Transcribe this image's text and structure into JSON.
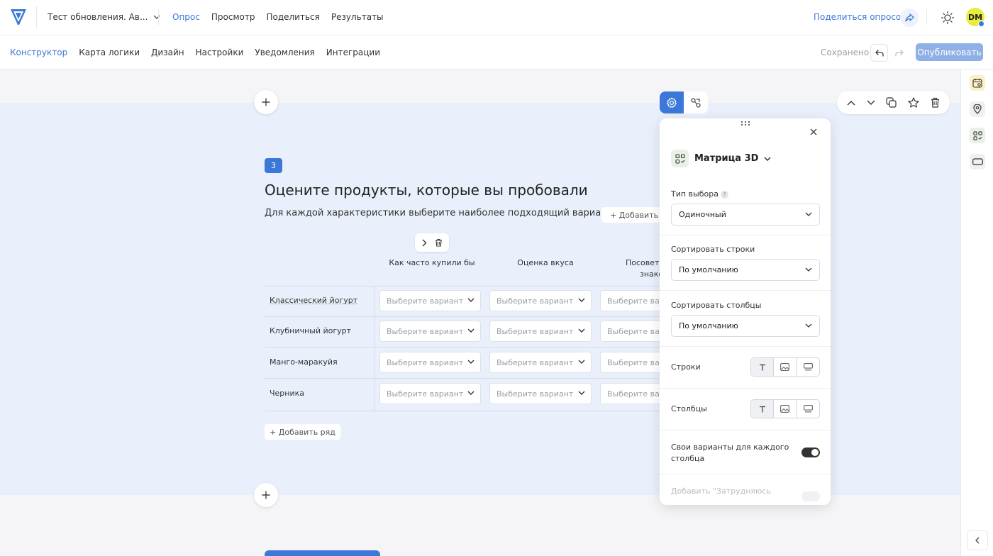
{
  "header": {
    "survey_title": "Тест обновления. Ав...",
    "nav": [
      "Опрос",
      "Просмотр",
      "Поделиться",
      "Результаты"
    ],
    "share_survey": "Поделиться опросом",
    "avatar": "DM"
  },
  "subheader": {
    "tabs": [
      "Конструктор",
      "Карта логики",
      "Дизайн",
      "Настройки",
      "Уведомления",
      "Интеграции"
    ],
    "saved": "Сохранено",
    "publish": "Опубликовать"
  },
  "question": {
    "number": "3",
    "title": "Оцените продукты, которые вы пробовали",
    "description": "Для каждой характеристики выберите наиболее подходящий вариант.",
    "add_column": "+ Добавить с",
    "columns": [
      "Как часто купили бы",
      "Оценка вкуса",
      "Посовето",
      "знако"
    ],
    "rows": [
      "Классический йогурт",
      "Клубничный йогурт",
      "Манго-маракуйя",
      "Черника"
    ],
    "select_placeholder": "Выберите вариант",
    "select_placeholder_cut": "Выберите вар",
    "add_row": "+ Добавить ряд"
  },
  "panel": {
    "type_label": "Матрица 3D",
    "choice_type_label": "Тип выбора",
    "choice_type_value": "Одиночный",
    "sort_rows_label": "Сортировать строки",
    "sort_rows_value": "По умолчанию",
    "sort_cols_label": "Сортировать столбцы",
    "sort_cols_value": "По умолчанию",
    "rows_label": "Строки",
    "cols_label": "Столбцы",
    "own_options_label_1": "Свои варианты для каждого",
    "own_options_label_2": "столбца",
    "own_options_on": true,
    "difficult_label": "Добавить \"Затрудняюсь"
  },
  "colors": {
    "accent": "#3b78d8",
    "band": "#eaf0fb",
    "publish": "#8fb0e6",
    "avatar": "#e8ec3b"
  }
}
